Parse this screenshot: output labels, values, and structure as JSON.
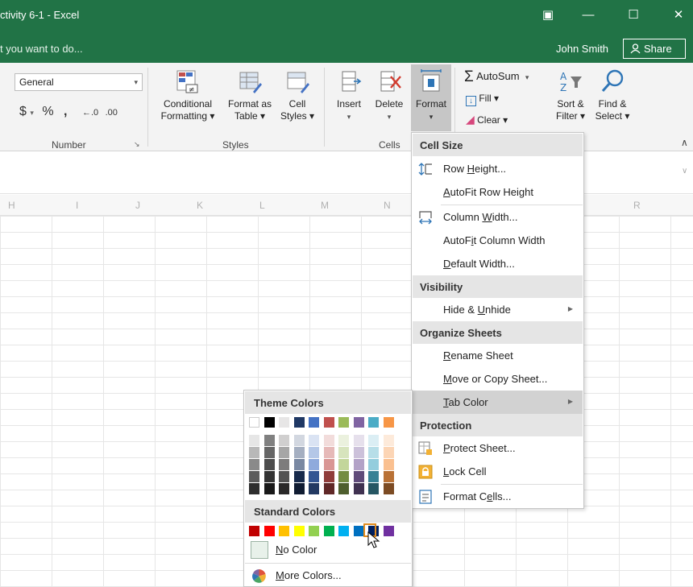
{
  "window": {
    "title": "ctivity 6-1 - Excel",
    "tell_me": "t you want to do...",
    "user": "John Smith",
    "share": "Share"
  },
  "ribbon": {
    "number_format": "General",
    "number_group_label": "Number",
    "styles_group_label": "Styles",
    "cells_group_label": "Cells",
    "conditional_formatting": [
      "Conditional",
      "Formatting ▾"
    ],
    "format_as_table": [
      "Format as",
      "Table ▾"
    ],
    "cell_styles": [
      "Cell",
      "Styles ▾"
    ],
    "insert": "Insert",
    "delete": "Delete",
    "format": "Format",
    "autosum": "AutoSum",
    "fill": "Fill ▾",
    "clear": "Clear ▾",
    "sort_filter": [
      "Sort &",
      "Filter ▾"
    ],
    "find_select": [
      "Find &",
      "Select ▾"
    ]
  },
  "columns": [
    "H",
    "I",
    "J",
    "K",
    "L",
    "M",
    "N",
    "R"
  ],
  "format_menu": {
    "cell_size": "Cell Size",
    "row_height": {
      "pre": "Row ",
      "u": "H",
      "post": "eight..."
    },
    "autofit_row": {
      "pre": "",
      "u": "A",
      "post": "utoFit Row Height"
    },
    "column_width": {
      "pre": "Column ",
      "u": "W",
      "post": "idth..."
    },
    "autofit_column": {
      "pre": "AutoF",
      "u": "i",
      "post": "t Column Width"
    },
    "default_width": {
      "pre": "",
      "u": "D",
      "post": "efault Width..."
    },
    "visibility": "Visibility",
    "hide_unhide": {
      "pre": "Hide & ",
      "u": "U",
      "post": "nhide"
    },
    "organize_sheets": "Organize Sheets",
    "rename_sheet": {
      "pre": "",
      "u": "R",
      "post": "ename Sheet"
    },
    "move_copy": {
      "pre": "",
      "u": "M",
      "post": "ove or Copy Sheet..."
    },
    "tab_color": {
      "pre": "",
      "u": "T",
      "post": "ab Color"
    },
    "protection": "Protection",
    "protect_sheet": {
      "pre": "",
      "u": "P",
      "post": "rotect Sheet..."
    },
    "lock_cell": {
      "pre": "",
      "u": "L",
      "post": "ock Cell"
    },
    "format_cells": {
      "pre": "Format C",
      "u": "e",
      "post": "lls..."
    }
  },
  "palette": {
    "theme_colors_label": "Theme Colors",
    "standard_colors_label": "Standard Colors",
    "no_color": {
      "pre": "",
      "u": "N",
      "post": "o Color"
    },
    "more_colors": {
      "pre": "",
      "u": "M",
      "post": "ore Colors..."
    },
    "theme_top": [
      "#FFFFFF",
      "#000000",
      "#E7E6E6",
      "#44546A",
      "#4472C4",
      "#ED7D31",
      "#A5A5A5",
      "#FFC000",
      "#5B9BD5",
      "#70AD47"
    ],
    "theme_top_visible": [
      "#FFFFFF",
      "#000000",
      "#E7E6E6",
      "#1F3864",
      "#4472C4",
      "#C0504D",
      "#9BBB59",
      "#8064A2",
      "#4BACC6",
      "#F79646"
    ],
    "standard": [
      "#C00000",
      "#FF0000",
      "#FFC000",
      "#FFFF00",
      "#92D050",
      "#00B050",
      "#00B0F0",
      "#0070C0",
      "#002060",
      "#7030A0"
    ],
    "selected_standard_index": 7
  }
}
